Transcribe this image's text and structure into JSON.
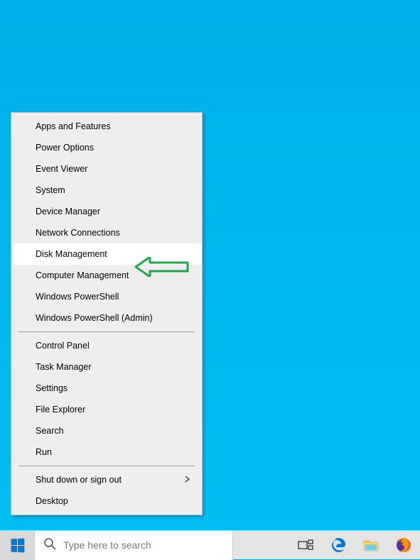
{
  "menu": {
    "group1": [
      {
        "label": "Apps and Features"
      },
      {
        "label": "Power Options"
      },
      {
        "label": "Event Viewer"
      },
      {
        "label": "System"
      },
      {
        "label": "Device Manager"
      },
      {
        "label": "Network Connections"
      },
      {
        "label": "Disk Management",
        "highlighted": true
      },
      {
        "label": "Computer Management"
      },
      {
        "label": "Windows PowerShell"
      },
      {
        "label": "Windows PowerShell (Admin)"
      }
    ],
    "group2": [
      {
        "label": "Control Panel"
      },
      {
        "label": "Task Manager"
      },
      {
        "label": "Settings"
      },
      {
        "label": "File Explorer"
      },
      {
        "label": "Search"
      },
      {
        "label": "Run"
      }
    ],
    "group3": [
      {
        "label": "Shut down or sign out",
        "submenu": true
      },
      {
        "label": "Desktop"
      }
    ]
  },
  "taskbar": {
    "search_placeholder": "Type here to search"
  },
  "annotation": {
    "arrow_color": "#1ea84a"
  }
}
